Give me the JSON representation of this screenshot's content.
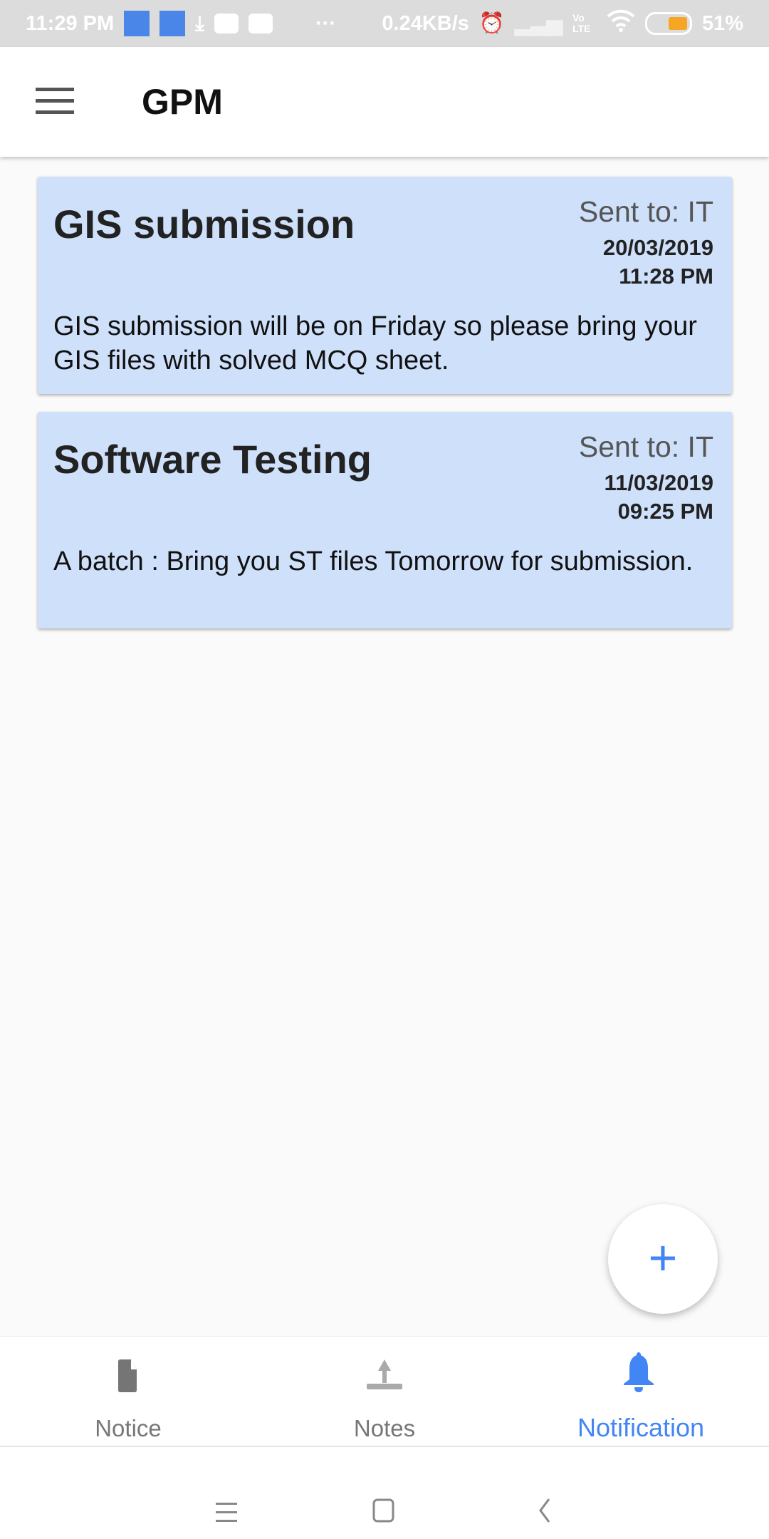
{
  "status_bar": {
    "time": "11:29 PM",
    "network_speed": "0.24KB/s",
    "more": "···",
    "volte": "Vo LTE",
    "battery": "51%"
  },
  "app_bar": {
    "title": "GPM",
    "menu_icon": "hamburger-icon"
  },
  "notifications": [
    {
      "title": "GIS submission",
      "sent_to": "Sent to: IT",
      "date": "20/03/2019",
      "time": "11:28 PM",
      "body": "GIS submission will be on Friday so please bring your GIS files with solved MCQ sheet."
    },
    {
      "title": "Software Testing",
      "sent_to": "Sent to: IT",
      "date": "11/03/2019",
      "time": "09:25 PM",
      "body": "A batch : Bring you ST files Tomorrow for submission."
    }
  ],
  "fab": {
    "label": "+"
  },
  "bottom_nav": {
    "items": [
      {
        "label": "Notice",
        "icon": "file-icon"
      },
      {
        "label": "Notes",
        "icon": "upload-icon"
      },
      {
        "label": "Notification",
        "icon": "bell-icon",
        "active": true
      }
    ]
  },
  "colors": {
    "accent": "#4285f4",
    "card": "#cfe0fa"
  }
}
